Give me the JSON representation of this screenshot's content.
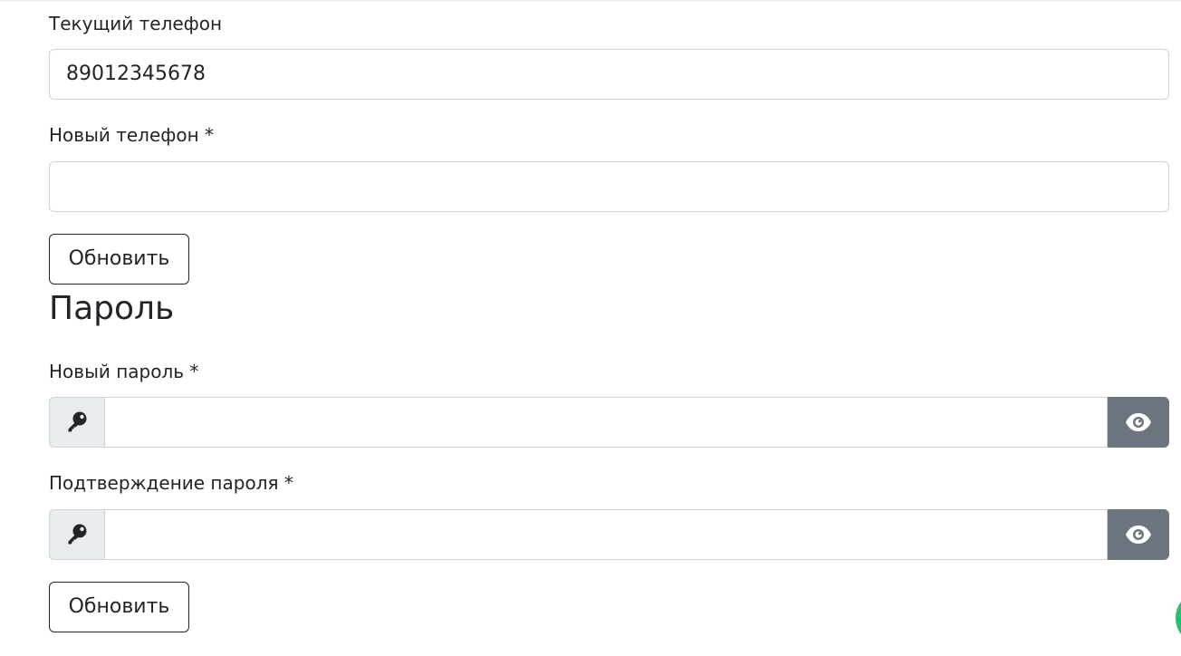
{
  "phone": {
    "current_label": "Текущий телефон",
    "current_value": "89012345678",
    "new_label": "Новый телефон *",
    "new_value": "",
    "update_label": "Обновить"
  },
  "password": {
    "section_title": "Пароль",
    "new_label": "Новый пароль *",
    "confirm_label": "Подтверждение пароля *",
    "update_label": "Обновить",
    "key_icon": "key-icon",
    "eye_icon": "eye-icon"
  },
  "colors": {
    "addon_bg": "#e9ecef",
    "eye_button_bg": "#6c757d",
    "border": "#ced4da",
    "fab_green": "#25c16f"
  }
}
